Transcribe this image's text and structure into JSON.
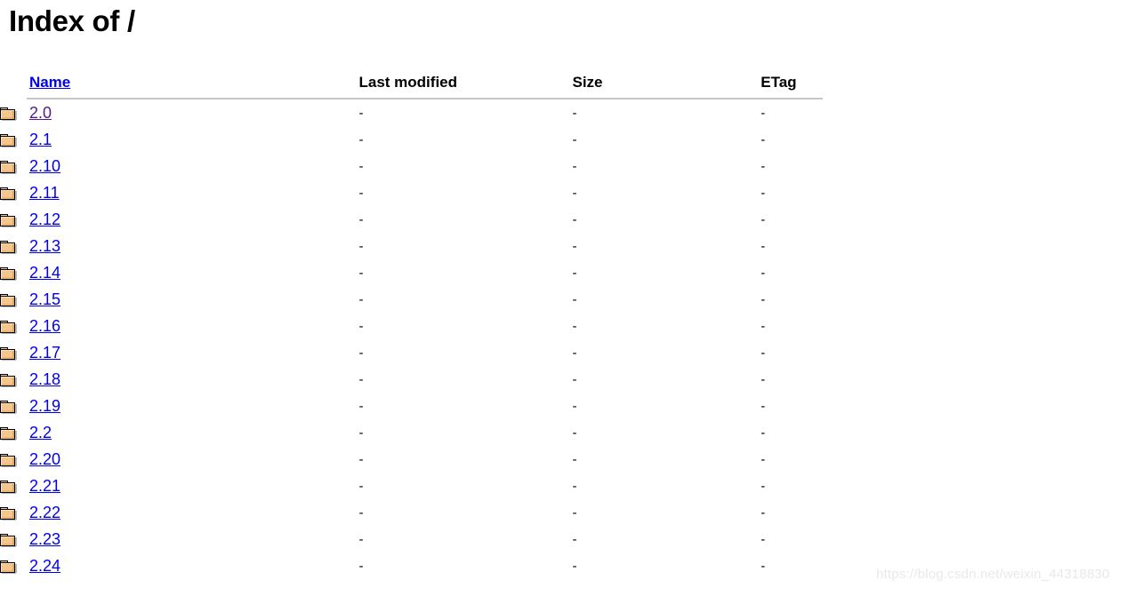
{
  "page": {
    "title": "Index of /",
    "watermark": "https://blog.csdn.net/weixin_44318830"
  },
  "colors": {
    "link": "#0000EE",
    "link_visited": "#551A8B",
    "text": "#000000",
    "rule": "#9a9a9a",
    "watermark": "#e9e9e9",
    "folder_fill": "#F5C78D",
    "folder_outline": "#000000"
  },
  "table": {
    "headers": {
      "name": "Name",
      "last_modified": "Last modified",
      "size": "Size",
      "etag": "ETag"
    },
    "icon_name": "folder-icon",
    "rows": [
      {
        "name": "2.0",
        "last_modified": "-",
        "size": "-",
        "etag": "-",
        "visited": true
      },
      {
        "name": "2.1",
        "last_modified": "-",
        "size": "-",
        "etag": "-",
        "visited": false
      },
      {
        "name": "2.10",
        "last_modified": "-",
        "size": "-",
        "etag": "-",
        "visited": false
      },
      {
        "name": "2.11",
        "last_modified": "-",
        "size": "-",
        "etag": "-",
        "visited": false
      },
      {
        "name": "2.12",
        "last_modified": "-",
        "size": "-",
        "etag": "-",
        "visited": false
      },
      {
        "name": "2.13",
        "last_modified": "-",
        "size": "-",
        "etag": "-",
        "visited": false
      },
      {
        "name": "2.14",
        "last_modified": "-",
        "size": "-",
        "etag": "-",
        "visited": false
      },
      {
        "name": "2.15",
        "last_modified": "-",
        "size": "-",
        "etag": "-",
        "visited": false
      },
      {
        "name": "2.16",
        "last_modified": "-",
        "size": "-",
        "etag": "-",
        "visited": false
      },
      {
        "name": "2.17",
        "last_modified": "-",
        "size": "-",
        "etag": "-",
        "visited": false
      },
      {
        "name": "2.18",
        "last_modified": "-",
        "size": "-",
        "etag": "-",
        "visited": false
      },
      {
        "name": "2.19",
        "last_modified": "-",
        "size": "-",
        "etag": "-",
        "visited": false
      },
      {
        "name": "2.2",
        "last_modified": "-",
        "size": "-",
        "etag": "-",
        "visited": false
      },
      {
        "name": "2.20",
        "last_modified": "-",
        "size": "-",
        "etag": "-",
        "visited": false
      },
      {
        "name": "2.21",
        "last_modified": "-",
        "size": "-",
        "etag": "-",
        "visited": false
      },
      {
        "name": "2.22",
        "last_modified": "-",
        "size": "-",
        "etag": "-",
        "visited": false
      },
      {
        "name": "2.23",
        "last_modified": "-",
        "size": "-",
        "etag": "-",
        "visited": false
      },
      {
        "name": "2.24",
        "last_modified": "-",
        "size": "-",
        "etag": "-",
        "visited": false
      }
    ]
  }
}
